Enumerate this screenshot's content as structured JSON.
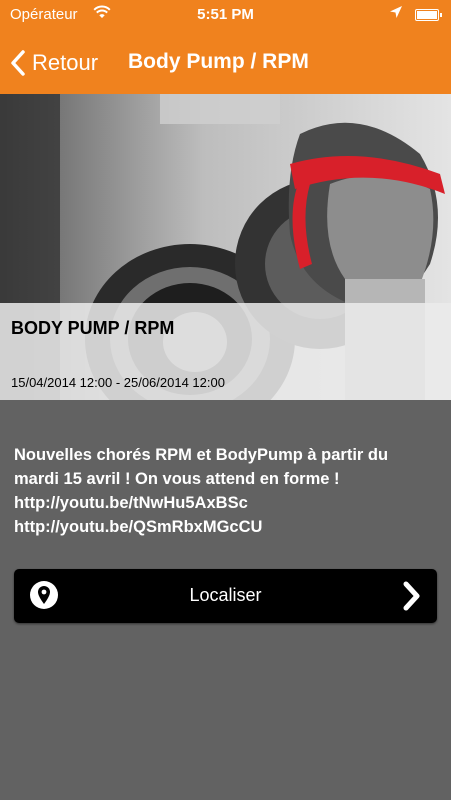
{
  "status_bar": {
    "carrier": "Opérateur",
    "time": "5:51 PM"
  },
  "nav": {
    "back_label": "Retour",
    "title": "Body Pump / RPM"
  },
  "event": {
    "title": "BODY PUMP / RPM",
    "dates": "15/04/2014 12:00 - 25/06/2014 12:00",
    "description_lines": [
      "Nouvelles chorés RPM et BodyPump à partir du",
      "mardi 15 avril ! On vous attend en forme !",
      "http://youtu.be/tNwHu5AxBSc",
      "http://youtu.be/QSmRbxMGcCU"
    ]
  },
  "locate_button": {
    "label": "Localiser",
    "icon": "map-pin-icon",
    "chevron_icon": "chevron-right-icon"
  },
  "colors": {
    "header": "#f0821e",
    "background": "#626262",
    "accent_red": "#d8202a"
  }
}
